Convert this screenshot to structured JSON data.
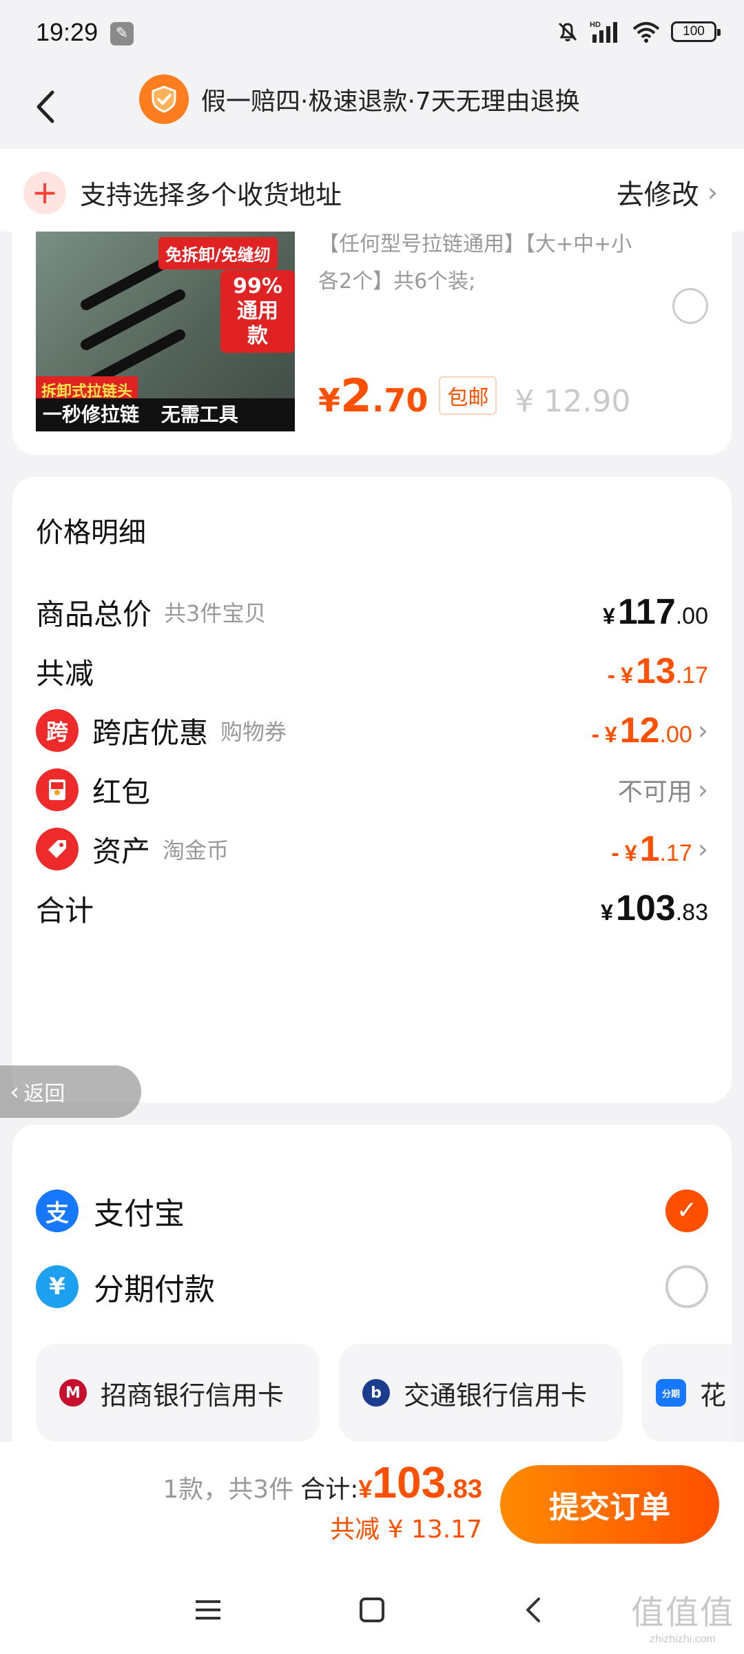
{
  "status_bar": {
    "time": "19:29",
    "battery": "100"
  },
  "header": {
    "guarantee": "假一赔四·极速退款·7天无理由退换"
  },
  "address_bar": {
    "text": "支持选择多个收货地址",
    "action": "去修改"
  },
  "product": {
    "image_tags": [
      "免拆卸/免缝纫",
      "99%通用款",
      "拆卸式拉链头",
      "一秒修拉链",
      "无需工具"
    ],
    "description": "【任何型号拉链通用】【大+中+小各2个】共6个装;",
    "price_yen": "¥",
    "price_int": "2",
    "price_dec": ".70",
    "shipping_tag": "包邮",
    "original_price": "¥ 12.90"
  },
  "price_detail": {
    "title": "价格明细",
    "rows": [
      {
        "label": "商品总价",
        "sub": "共3件宝贝",
        "yen": "¥",
        "int": "117",
        "dec": ".00"
      },
      {
        "label": "共减",
        "sub": "",
        "minus": "-",
        "yen": "¥",
        "int": "13",
        "dec": ".17"
      },
      {
        "label": "跨店优惠",
        "sub": "购物券",
        "icon_char": "跨",
        "minus": "-",
        "yen": "¥",
        "int": "12",
        "dec": ".00"
      },
      {
        "label": "红包",
        "sub": "",
        "status": "不可用"
      },
      {
        "label": "资产",
        "sub": "淘金币",
        "minus": "-",
        "yen": "¥",
        "int": "1",
        "dec": ".17"
      },
      {
        "label": "合计",
        "sub": "",
        "yen": "¥",
        "int": "103",
        "dec": ".83"
      }
    ]
  },
  "floating_back": "返回",
  "payment": {
    "options": [
      {
        "label": "支付宝",
        "icon_char": "支",
        "selected": true
      },
      {
        "label": "分期付款",
        "icon_char": "¥",
        "selected": false
      }
    ],
    "cards": [
      {
        "label": "招商银行信用卡"
      },
      {
        "label": "交通银行信用卡"
      },
      {
        "label": "花",
        "icon_text": "分期"
      }
    ]
  },
  "bottom_bar": {
    "count": "1款，共3件",
    "total_label": "合计:",
    "total_yen": "¥",
    "total_int": "103",
    "total_dec": ".83",
    "discount": "共减 ¥ 13.17",
    "submit": "提交订单"
  },
  "watermark": {
    "big": "值值值",
    "small": "zhizhizhi.com"
  },
  "colors": {
    "accent": "#ff5000",
    "alipay": "#1677ff",
    "installment": "#1ea0f0",
    "coupon_red": "#ee2a2a"
  }
}
